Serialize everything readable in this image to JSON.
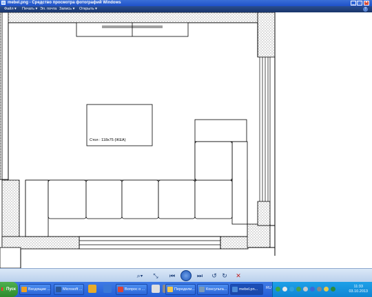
{
  "window": {
    "title": "mebel.png - Средство просмотра фотографий Windows",
    "minimize": "_",
    "maximize": "□",
    "close": "✕"
  },
  "menu": {
    "items": [
      "Файл ▾",
      "Печать ▾",
      "Эл. почта",
      "Запись ▾",
      "Открыть ▾"
    ],
    "help": "?"
  },
  "plan": {
    "table_label": "Стол : 118x75 (IKEA)"
  },
  "viewer_toolbar": {
    "zoom": "⌕▾",
    "fit": "⤡",
    "prev": "⏮",
    "next": "⏭",
    "rotate_left": "↺",
    "rotate_right": "↻",
    "delete": "✕"
  },
  "taskbar": {
    "start_label": "Пуск",
    "tasks": [
      {
        "label": "Входящие ...",
        "icon_color": "#f0a020"
      },
      {
        "label": "Microsoft ...",
        "icon_color": "#2b579a"
      },
      {
        "label": "Вопрос о ...",
        "icon_color": "#db4437"
      },
      {
        "label": "Передели...",
        "icon_color": "#f2c84b"
      },
      {
        "label": "Консульта...",
        "icon_color": "#7a9ab8"
      },
      {
        "label": "mebel.pn...",
        "icon_color": "#4a8ad8"
      }
    ],
    "quicklaunch_colors": [
      "#e8ab28",
      "#3a78d8",
      "#dfdfdf",
      "#8a8a8a",
      "#4a7ac8"
    ],
    "tray": {
      "language": "RU",
      "time": "11:33",
      "date": "03.10.2013",
      "icon_colors": [
        "#3aa845",
        "#e8e8e8",
        "#2ea0e0",
        "#4aa04a",
        "#c8c8c8",
        "#3a6ad8",
        "#888888",
        "#e8c84a",
        "#2a8a3a"
      ]
    }
  }
}
